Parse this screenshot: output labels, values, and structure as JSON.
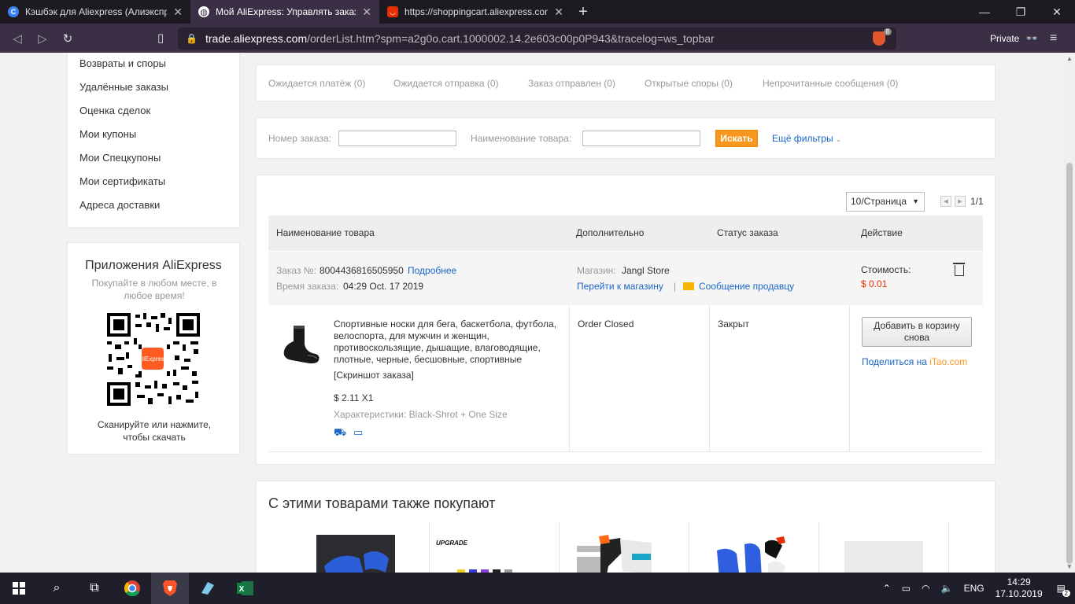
{
  "browser": {
    "tabs": [
      {
        "title": "Кэшбэк для Aliexpress (Алиэкспресс)",
        "favicon": "C",
        "active": false
      },
      {
        "title": "Мой AliExpress: Управлять заказами",
        "favicon": "globe",
        "active": true
      },
      {
        "title": "https://shoppingcart.aliexpress.com",
        "favicon": "ali",
        "active": false
      }
    ],
    "new_tab": "+",
    "url_host": "trade.aliexpress.com",
    "url_rest": "/orderList.htm?spm=a2g0o.cart.1000002.14.2e603c00p0P943&tracelog=ws_topbar",
    "shield_count": "8",
    "private_label": "Private"
  },
  "sidebar": {
    "items": [
      "Возвраты и споры",
      "Удалённые заказы",
      "Оценка сделок",
      "Мои купоны",
      "Мои Спецкупоны",
      "Мои сертификаты",
      "Адреса доставки"
    ]
  },
  "apps": {
    "title": "Приложения AliExpress",
    "subtitle": "Покупайте в любом месте, в любое время!",
    "qr_logo": "AliExpress",
    "scan_text": "Сканируйте или нажмите, чтобы скачать"
  },
  "status_tabs": [
    "Ожидается платёж (0)",
    "Ожидается отправка (0)",
    "Заказ отправлен (0)",
    "Открытые споры (0)",
    "Непрочитанные сообщения (0)"
  ],
  "search": {
    "order_label": "Номер заказа:",
    "product_label": "Наименование товара:",
    "button": "Искать",
    "more_filters": "Ещё фильтры"
  },
  "pagination": {
    "per_page": "10/Страница",
    "page": "1/1"
  },
  "table": {
    "headers": [
      "Наименование товара",
      "Дополнительно",
      "Статус заказа",
      "Действие"
    ]
  },
  "order": {
    "number_label": "Заказ №:",
    "number": "8004436816505950",
    "details_link": "Подробнее",
    "time_label": "Время заказа:",
    "time": "04:29 Oct. 17 2019",
    "store_label": "Магазин:",
    "store": "Jangl Store",
    "go_store": "Перейти к магазину",
    "message_seller": "Сообщение продавцу",
    "cost_label": "Стоимость:",
    "cost": "$ 0.01",
    "product_name": "Спортивные носки для бега, баскетбола, футбола, велоспорта, для мужчин и женщин, противоскользящие, дышащие, влаговодящие, плотные, черные, бесшовные, спортивные",
    "snapshot": "[Скриншот заказа]",
    "unit_price": "$ 2.11 X1",
    "attributes": "Характеристики: Black-Shrot + One Size",
    "extra_status": "Order Closed",
    "status": "Закрыт",
    "readd_button": "Добавить в корзину снова",
    "share_prefix": "Поделиться на ",
    "share_site": "iTao.com"
  },
  "also_bought": {
    "title": "С этими товарами также покупают",
    "upgrade_label": "UPGRADE"
  },
  "taskbar": {
    "lang": "ENG",
    "time": "14:29",
    "date": "17.10.2019",
    "notif_count": "2"
  }
}
